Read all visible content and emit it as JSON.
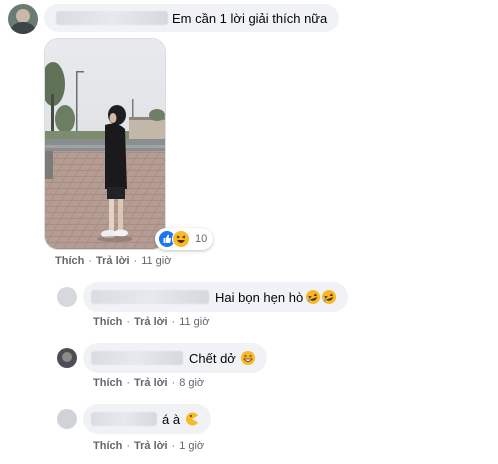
{
  "colors": {
    "bubble_bg": "#f0f2f5",
    "meta_text": "#65676b",
    "like_blue": "#1877f2",
    "haha_yellow": "#f7b928"
  },
  "comment": {
    "text": "Em cần 1 lời giải thích nữa",
    "reaction_count": "10",
    "reaction_icons": [
      "like-icon",
      "haha-icon"
    ],
    "actions": {
      "like": "Thích",
      "reply": "Trả lời",
      "time": "11 giờ"
    }
  },
  "replies": [
    {
      "text": "Hai bọn hẹn hò",
      "emojis": [
        "rofl-icon",
        "rofl-icon"
      ],
      "actions": {
        "like": "Thích",
        "reply": "Trả lời",
        "time": "11 giờ"
      }
    },
    {
      "text": "Chết dở",
      "emojis": [
        "grin-icon"
      ],
      "actions": {
        "like": "Thích",
        "reply": "Trả lời",
        "time": "8 giờ"
      }
    },
    {
      "text": "á à",
      "emojis": [
        "pacman-icon"
      ],
      "actions": {
        "like": "Thích",
        "reply": "Trả lời",
        "time": "1 giờ"
      }
    }
  ]
}
